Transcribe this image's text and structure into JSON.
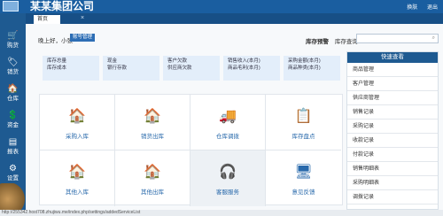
{
  "header": {
    "title": "某某集团公司",
    "links": [
      "换肤",
      "退出"
    ]
  },
  "sidebar": {
    "items": [
      {
        "label": "购货",
        "icon": "cart-icon",
        "glyph": "🛒"
      },
      {
        "label": "销货",
        "icon": "sale-icon",
        "glyph": "🏷"
      },
      {
        "label": "仓库",
        "icon": "warehouse-icon",
        "glyph": "🏠"
      },
      {
        "label": "资金",
        "icon": "money-icon",
        "glyph": "💲"
      },
      {
        "label": "报表",
        "icon": "report-icon",
        "glyph": "▤"
      },
      {
        "label": "设置",
        "icon": "gear-icon",
        "glyph": "⚙"
      }
    ]
  },
  "tabs": [
    {
      "label": "首页"
    }
  ],
  "main": {
    "greeting": "晚上好，小张",
    "badge": "账号管理",
    "right_label_bold": "库存预警",
    "right_label": "库存查询",
    "search_placeholder": ""
  },
  "stats": [
    {
      "line1": "库存总量",
      "line2": "库存成本"
    },
    {
      "line1": "现金",
      "line2": "银行存款"
    },
    {
      "line1": "客户欠款",
      "line2": "供应商欠款"
    },
    {
      "line1": "销售收入(本月)",
      "line2": "商品毛利(本月)"
    },
    {
      "line1": "采购金额(本月)",
      "line2": "商品种类(本月)"
    }
  ],
  "grid": [
    {
      "label": "采购入库",
      "icon": "purchase-in-icon",
      "glyph": "🏠"
    },
    {
      "label": "销货出库",
      "icon": "sale-out-icon",
      "glyph": "🏠"
    },
    {
      "label": "仓库调拨",
      "icon": "truck-icon",
      "glyph": "🚚"
    },
    {
      "label": "库存盘点",
      "icon": "inventory-icon",
      "glyph": "📋"
    },
    {
      "label": "其他入库",
      "icon": "other-in-icon",
      "glyph": "🏠"
    },
    {
      "label": "其他出库",
      "icon": "other-out-icon",
      "glyph": "🏠"
    },
    {
      "label": "客服服务",
      "icon": "service-icon",
      "glyph": "🎧"
    },
    {
      "label": "意见反馈",
      "icon": "feedback-icon",
      "glyph": "🖥"
    }
  ],
  "quick": {
    "title": "快速查看",
    "items": [
      "商品管理",
      "客户管理",
      "供应商管理",
      "销售记录",
      "采购记录",
      "收款记录",
      "付款记录",
      "销售明细表",
      "采购明细表",
      "调拨记录"
    ]
  },
  "status_url": "http://255342.host708.zhujiwu.me/index.php/settings/addedServiceList"
}
